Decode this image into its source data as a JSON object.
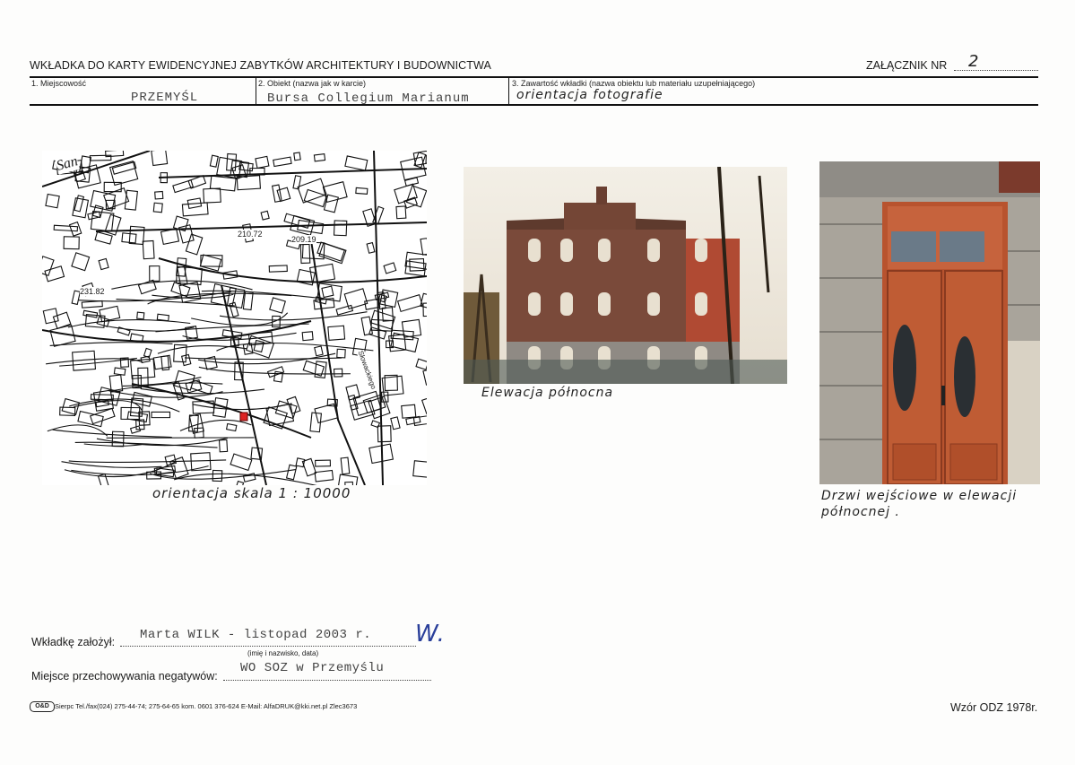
{
  "header": {
    "title": "WKŁADKA DO KARTY EWIDENCYJNEJ ZABYTKÓW ARCHITEKTURY I BUDOWNICTWA",
    "annex_label": "ZAŁĄCZNIK NR",
    "annex_number": "2"
  },
  "fields": {
    "locality_label": "1. Miejscowość",
    "locality_value": "PRZEMYŚL",
    "object_label": "2. Obiekt (nazwa jak w karcie)",
    "object_value": "Bursa Collegium Marianum",
    "content_label": "3. Zawartość wkładki (nazwa obiektu lub materiału uzupełniającego)",
    "content_value": "orientacja  fotografie"
  },
  "map": {
    "caption": "orientacja  skala  1 : 10000",
    "labels": [
      "San",
      "210.72",
      "209.19",
      "231.82",
      "Słowackiego"
    ]
  },
  "photos": [
    {
      "caption": "Elewacja  północna"
    },
    {
      "caption_line1": "Drzwi  wejściowe  w  elewacji",
      "caption_line2": "północnej ."
    }
  ],
  "footer": {
    "created_by_label": "Wkładkę założył:",
    "created_by_value": "Marta WILK - listopad 2003 r.",
    "initials": "W.",
    "name_hint": "(imię i nazwisko, data)",
    "negatives_label": "Miejsce przechowywania negatywów:",
    "negatives_value": "WO SOZ w Przemyślu",
    "printer_logo": "O&D",
    "printer_text": "Sierpc Tel./fax(024) 275-44-74; 275-64-65 kom. 0601 376-624  E-Mail: AlfaDRUK@kki.net.pl  Zlec3673",
    "template": "Wzór ODZ 1978r."
  },
  "colors": {
    "ink": "#1a1a1a",
    "typewriter": "#444444",
    "signature": "#2a3f9a",
    "brick": "#7a4a3a",
    "door": "#b8532e"
  }
}
